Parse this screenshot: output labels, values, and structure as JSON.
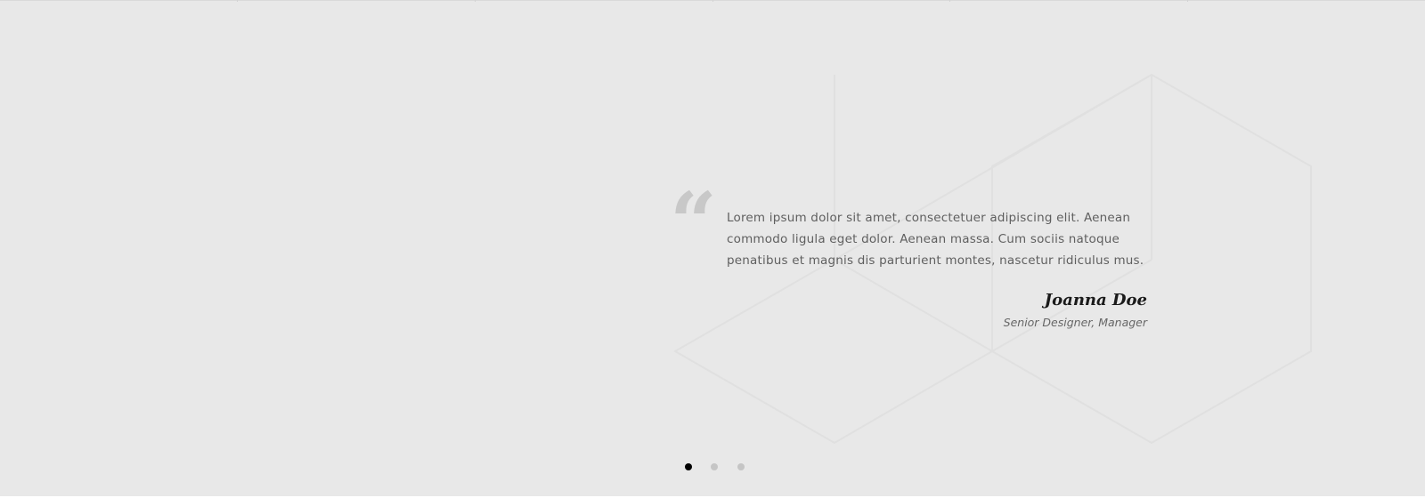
{
  "testimonial": {
    "quote": "Lorem ipsum dolor sit amet, consectetuer adipiscing elit. Aenean commodo ligula eget dolor. Aenean massa. Cum sociis natoque penatibus et magnis dis parturient montes, nascetur ridiculus mus.",
    "author": "Joanna Doe",
    "role": "Senior Designer, Manager",
    "quote_glyph": "“"
  },
  "pagination": {
    "total": 3,
    "active_index": 0
  },
  "colors": {
    "background": "#e8e8e8",
    "quote_mark": "#c8c8c8",
    "dot_active": "#000000",
    "dot_inactive": "#c5c5c5"
  }
}
